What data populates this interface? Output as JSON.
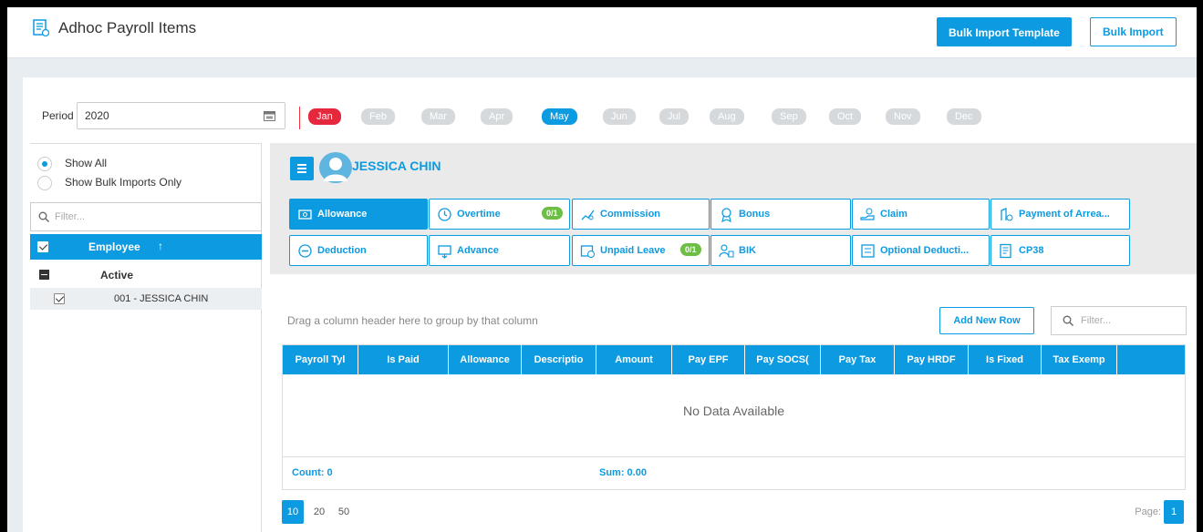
{
  "header": {
    "title": "Adhoc Payroll Items",
    "bulk_import_template": "Bulk Import Template",
    "bulk_import": "Bulk Import"
  },
  "period": {
    "label": "Period",
    "value": "2020"
  },
  "months": [
    {
      "label": "Jan",
      "state": "selected-red"
    },
    {
      "label": "Feb",
      "state": "disabled"
    },
    {
      "label": "Mar",
      "state": "disabled"
    },
    {
      "label": "Apr",
      "state": "disabled"
    },
    {
      "label": "May",
      "state": "active"
    },
    {
      "label": "Jun",
      "state": "disabled"
    },
    {
      "label": "Jul",
      "state": "disabled"
    },
    {
      "label": "Aug",
      "state": "disabled"
    },
    {
      "label": "Sep",
      "state": "disabled"
    },
    {
      "label": "Oct",
      "state": "disabled"
    },
    {
      "label": "Nov",
      "state": "disabled"
    },
    {
      "label": "Dec",
      "state": "disabled"
    }
  ],
  "left_panel": {
    "show_all": "Show All",
    "show_bulk": "Show Bulk Imports Only",
    "filter_placeholder": "Filter...",
    "employee_header": "Employee",
    "sort_indicator": "↑",
    "group_label": "Active",
    "employees": [
      "001 - JESSICA CHIN"
    ]
  },
  "employee": {
    "name": "JESSICA CHIN"
  },
  "tabs": [
    {
      "label": "Allowance",
      "icon": "allowance-icon",
      "badge": ""
    },
    {
      "label": "Overtime",
      "icon": "overtime-icon",
      "badge": "0/1"
    },
    {
      "label": "Commission",
      "icon": "commission-icon",
      "badge": ""
    },
    {
      "label": "Bonus",
      "icon": "bonus-icon",
      "badge": ""
    },
    {
      "label": "Claim",
      "icon": "claim-icon",
      "badge": ""
    },
    {
      "label": "Payment of Arrea...",
      "icon": "payment-icon",
      "badge": ""
    },
    {
      "label": "Deduction",
      "icon": "deduction-icon",
      "badge": ""
    },
    {
      "label": "Advance",
      "icon": "advance-icon",
      "badge": ""
    },
    {
      "label": "Unpaid Leave",
      "icon": "unpaid-leave-icon",
      "badge": "0/1"
    },
    {
      "label": "BIK",
      "icon": "bik-icon",
      "badge": ""
    },
    {
      "label": "Optional Deducti...",
      "icon": "optional-deduction-icon",
      "badge": ""
    },
    {
      "label": "CP38",
      "icon": "cp38-icon",
      "badge": ""
    }
  ],
  "grid": {
    "drag_hint": "Drag a column header here to group by that column",
    "add_new_row": "Add New Row",
    "filter_placeholder": "Filter...",
    "columns": [
      "Payroll Tyl",
      "Is Paid",
      "Allowance",
      "Descriptio",
      "Amount",
      "Pay EPF",
      "Pay SOCS(",
      "Pay Tax",
      "Pay HRDF",
      "Is Fixed",
      "Tax Exemp"
    ],
    "no_data": "No Data Available",
    "count": "Count: 0",
    "sum": "Sum: 0.00"
  },
  "pager": {
    "sizes": [
      "10",
      "20",
      "50"
    ],
    "page_label": "Page:",
    "current_page": "1"
  },
  "colors": {
    "accent": "#0c9ae0",
    "month_selected": "#e6283c",
    "badge": "#6dbe45"
  }
}
